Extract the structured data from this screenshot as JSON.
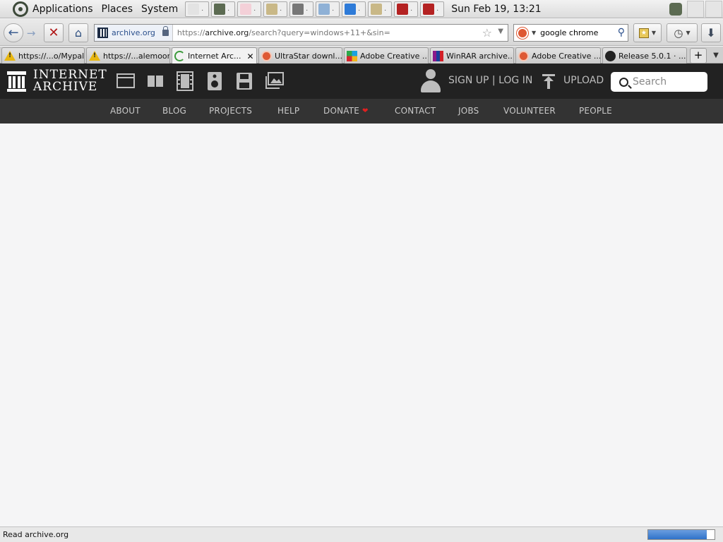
{
  "panel": {
    "menus": [
      "Applications",
      "Places",
      "System"
    ],
    "launchers": [
      {
        "icon": "file-manager-icon",
        "color": "#e3e3e3"
      },
      {
        "icon": "pale-moon-raccoon-icon",
        "color": "#5c6b52"
      },
      {
        "icon": "pixel-art-icon",
        "color": "#f4d0d8"
      },
      {
        "icon": "chart-app-icon",
        "color": "#c9b887"
      },
      {
        "icon": "terminal-icon",
        "color": "#777777"
      },
      {
        "icon": "globe-settings-icon",
        "color": "#8fb1d6"
      },
      {
        "icon": "chrome-icon",
        "color": "#2e7bd8"
      },
      {
        "icon": "chart-app-icon",
        "color": "#c9b887"
      },
      {
        "icon": "winrar-icon",
        "color": "#b42222"
      },
      {
        "icon": "winrar-icon",
        "color": "#b42222"
      }
    ],
    "clock": "Sun Feb 19, 13:21"
  },
  "browser": {
    "identity_host": "archive.org",
    "url_prefix": "https://",
    "url_host": "archive.org",
    "url_rest": "/search?query=windows+11+&sin=",
    "search_engine_query": "google chrome",
    "tabs": [
      {
        "label": "https://...o/Mypal/",
        "favicon": "warning-icon",
        "active": false
      },
      {
        "label": "https://...alemoon",
        "favicon": "warning-icon",
        "active": false
      },
      {
        "label": "Internet Arc...",
        "favicon": "loading-spinner-icon",
        "active": true
      },
      {
        "label": "UltraStar downl...",
        "favicon": "duckduckgo-icon",
        "active": false
      },
      {
        "label": "Adobe Creative ...",
        "favicon": "adobe-icon",
        "active": false
      },
      {
        "label": "WinRAR archive...",
        "favicon": "winrar-icon",
        "active": false
      },
      {
        "label": "Adobe Creative ...",
        "favicon": "duckduckgo-icon",
        "active": false
      },
      {
        "label": "Release 5.0.1 · ...",
        "favicon": "github-icon",
        "active": false
      }
    ],
    "status": "Read archive.org",
    "progress_fraction": 0.88
  },
  "archive": {
    "logo_line1": "INTERNET",
    "logo_line2": "ARCHIVE",
    "media_icons": [
      "web-icon",
      "texts-icon",
      "video-icon",
      "audio-icon",
      "software-icon",
      "images-icon"
    ],
    "account": "SIGN UP | LOG IN",
    "upload": "UPLOAD",
    "search_placeholder": "Search",
    "nav": [
      "ABOUT",
      "BLOG",
      "PROJECTS",
      "HELP",
      "DONATE",
      "CONTACT",
      "JOBS",
      "VOLUNTEER",
      "PEOPLE"
    ]
  }
}
